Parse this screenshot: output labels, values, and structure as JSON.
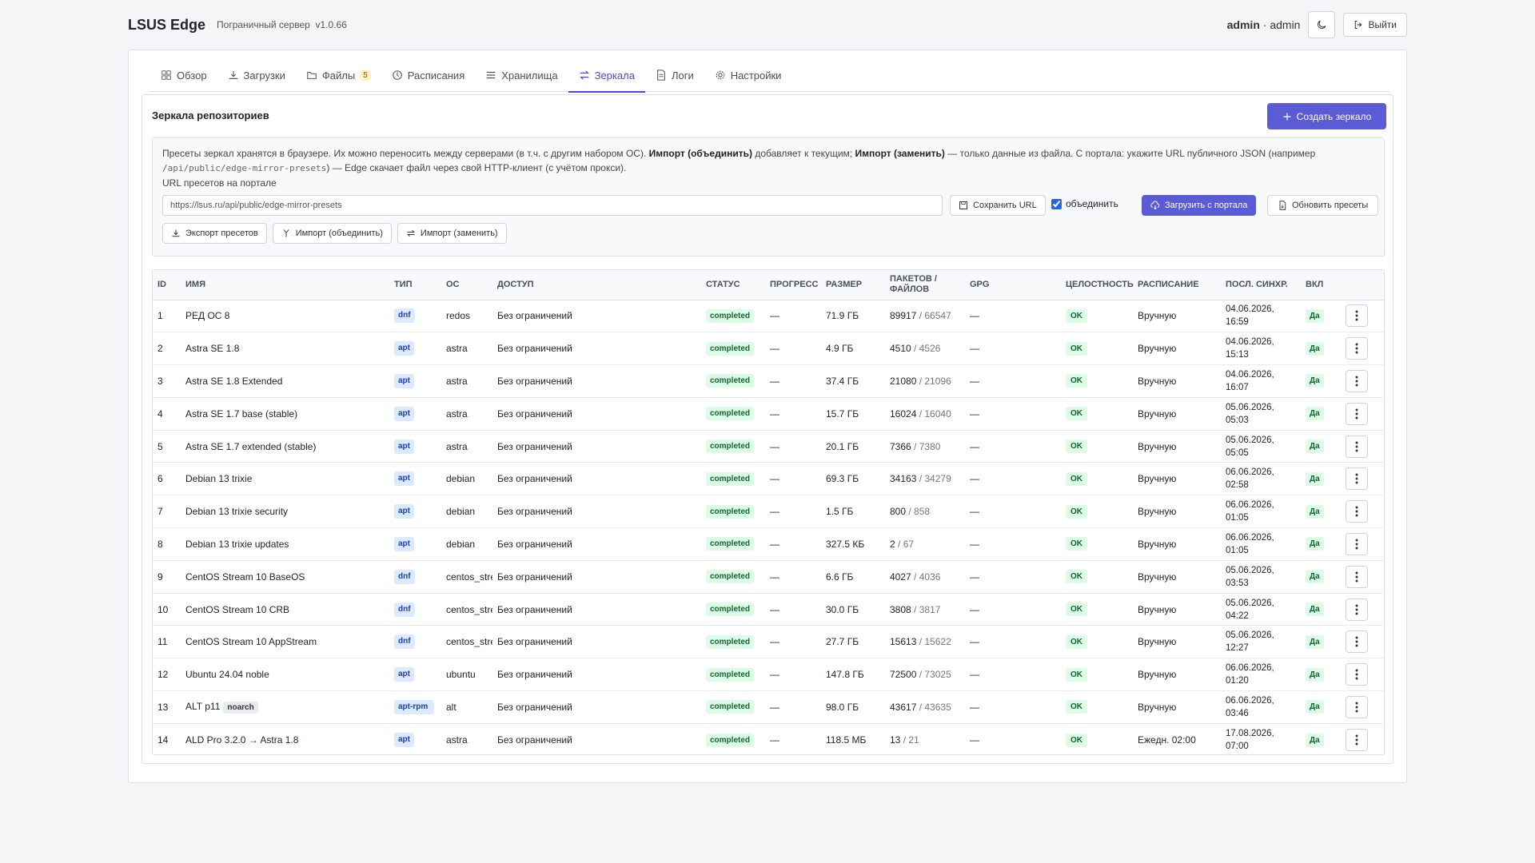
{
  "header": {
    "brand": "LSUS Edge",
    "subtitle": "Пограничный сервер",
    "version": "v1.0.66",
    "user_name": "admin",
    "user_role": "admin",
    "logout_label": "Выйти"
  },
  "tabs": [
    {
      "label": "Обзор",
      "icon": "grid-icon"
    },
    {
      "label": "Загрузки",
      "icon": "download-icon"
    },
    {
      "label": "Файлы",
      "icon": "folder-icon",
      "badge": "5"
    },
    {
      "label": "Расписания",
      "icon": "clock-icon"
    },
    {
      "label": "Хранилища",
      "icon": "list-icon"
    },
    {
      "label": "Зеркала",
      "icon": "arrows-icon",
      "active": true
    },
    {
      "label": "Логи",
      "icon": "document-icon"
    },
    {
      "label": "Настройки",
      "icon": "gear-icon"
    }
  ],
  "section": {
    "title": "Зеркала репозиториев",
    "create_label": "Создать зеркало"
  },
  "presets": {
    "info_1": "Пресеты зеркал хранятся в браузере. Их можно переносить между серверами (в т.ч. с другим набором ОС).",
    "info_import_merge": "Импорт (объединить)",
    "info_2": "добавляет к текущим;",
    "info_import_replace": "Импорт (заменить)",
    "info_3": "— только данные из файла. С портала: укажите URL публичного JSON (например",
    "info_path": "/api/public/edge-mirror-presets",
    "info_4": ") — Edge скачает файл через свой HTTP-клиент (с учётом прокси).",
    "url_label": "URL пресетов на портале",
    "url_value": "https://lsus.ru/api/public/edge-mirror-presets",
    "save_url_label": "Сохранить URL",
    "merge_label": "объединить",
    "merge_checked": true,
    "load_portal_label": "Загрузить с портала",
    "refresh_label": "Обновить пресеты",
    "export_label": "Экспорт пресетов",
    "import_merge_label": "Импорт (объединить)",
    "import_replace_label": "Импорт (заменить)"
  },
  "table": {
    "headers": [
      "ID",
      "Имя",
      "Тип",
      "ОС",
      "Доступ",
      "Статус",
      "Прогресс",
      "Размер",
      "Пакетов / файлов",
      "GPG",
      "Целостность",
      "Расписание",
      "Посл. синхр.",
      "Вкл",
      ""
    ],
    "rows": [
      {
        "id": "1",
        "name": "РЕД ОС 8",
        "tag": "",
        "type": "dnf",
        "os": "redos",
        "access": "Без ограничений",
        "status": "completed",
        "progress": "—",
        "size": "71.9 ГБ",
        "packages": "89917",
        "files": "/ 66547",
        "gpg": "—",
        "integrity": "OK",
        "schedule": "Вручную",
        "last_sync_date": "04.06.2026,",
        "last_sync_time": "16:59",
        "enabled": "Да"
      },
      {
        "id": "2",
        "name": "Astra SE 1.8",
        "tag": "",
        "type": "apt",
        "os": "astra",
        "access": "Без ограничений",
        "status": "completed",
        "progress": "—",
        "size": "4.9 ГБ",
        "packages": "4510",
        "files": "/ 4526",
        "gpg": "—",
        "integrity": "OK",
        "schedule": "Вручную",
        "last_sync_date": "04.06.2026,",
        "last_sync_time": "15:13",
        "enabled": "Да"
      },
      {
        "id": "3",
        "name": "Astra SE 1.8 Extended",
        "tag": "",
        "type": "apt",
        "os": "astra",
        "access": "Без ограничений",
        "status": "completed",
        "progress": "—",
        "size": "37.4 ГБ",
        "packages": "21080",
        "files": "/ 21096",
        "gpg": "—",
        "integrity": "OK",
        "schedule": "Вручную",
        "last_sync_date": "04.06.2026,",
        "last_sync_time": "16:07",
        "enabled": "Да"
      },
      {
        "id": "4",
        "name": "Astra SE 1.7 base (stable)",
        "tag": "",
        "type": "apt",
        "os": "astra",
        "access": "Без ограничений",
        "status": "completed",
        "progress": "—",
        "size": "15.7 ГБ",
        "packages": "16024",
        "files": "/ 16040",
        "gpg": "—",
        "integrity": "OK",
        "schedule": "Вручную",
        "last_sync_date": "05.06.2026,",
        "last_sync_time": "05:03",
        "enabled": "Да"
      },
      {
        "id": "5",
        "name": "Astra SE 1.7 extended (stable)",
        "tag": "",
        "type": "apt",
        "os": "astra",
        "access": "Без ограничений",
        "status": "completed",
        "progress": "—",
        "size": "20.1 ГБ",
        "packages": "7366",
        "files": "/ 7380",
        "gpg": "—",
        "integrity": "OK",
        "schedule": "Вручную",
        "last_sync_date": "05.06.2026,",
        "last_sync_time": "05:05",
        "enabled": "Да"
      },
      {
        "id": "6",
        "name": "Debian 13 trixie",
        "tag": "",
        "type": "apt",
        "os": "debian",
        "access": "Без ограничений",
        "status": "completed",
        "progress": "—",
        "size": "69.3 ГБ",
        "packages": "34163",
        "files": "/ 34279",
        "gpg": "—",
        "integrity": "OK",
        "schedule": "Вручную",
        "last_sync_date": "06.06.2026,",
        "last_sync_time": "02:58",
        "enabled": "Да"
      },
      {
        "id": "7",
        "name": "Debian 13 trixie security",
        "tag": "",
        "type": "apt",
        "os": "debian",
        "access": "Без ограничений",
        "status": "completed",
        "progress": "—",
        "size": "1.5 ГБ",
        "packages": "800",
        "files": "/ 858",
        "gpg": "—",
        "integrity": "OK",
        "schedule": "Вручную",
        "last_sync_date": "06.06.2026,",
        "last_sync_time": "01:05",
        "enabled": "Да"
      },
      {
        "id": "8",
        "name": "Debian 13 trixie updates",
        "tag": "",
        "type": "apt",
        "os": "debian",
        "access": "Без ограничений",
        "status": "completed",
        "progress": "—",
        "size": "327.5 КБ",
        "packages": "2",
        "files": "/ 67",
        "gpg": "—",
        "integrity": "OK",
        "schedule": "Вручную",
        "last_sync_date": "06.06.2026,",
        "last_sync_time": "01:05",
        "enabled": "Да"
      },
      {
        "id": "9",
        "name": "CentOS Stream 10 BaseOS",
        "tag": "",
        "type": "dnf",
        "os": "centos_stream",
        "access": "Без ограничений",
        "status": "completed",
        "progress": "—",
        "size": "6.6 ГБ",
        "packages": "4027",
        "files": "/ 4036",
        "gpg": "—",
        "integrity": "OK",
        "schedule": "Вручную",
        "last_sync_date": "05.06.2026,",
        "last_sync_time": "03:53",
        "enabled": "Да"
      },
      {
        "id": "10",
        "name": "CentOS Stream 10 CRB",
        "tag": "",
        "type": "dnf",
        "os": "centos_stream",
        "access": "Без ограничений",
        "status": "completed",
        "progress": "—",
        "size": "30.0 ГБ",
        "packages": "3808",
        "files": "/ 3817",
        "gpg": "—",
        "integrity": "OK",
        "schedule": "Вручную",
        "last_sync_date": "05.06.2026,",
        "last_sync_time": "04:22",
        "enabled": "Да"
      },
      {
        "id": "11",
        "name": "CentOS Stream 10 AppStream",
        "tag": "",
        "type": "dnf",
        "os": "centos_stream",
        "access": "Без ограничений",
        "status": "completed",
        "progress": "—",
        "size": "27.7 ГБ",
        "packages": "15613",
        "files": "/ 15622",
        "gpg": "—",
        "integrity": "OK",
        "schedule": "Вручную",
        "last_sync_date": "05.06.2026,",
        "last_sync_time": "12:27",
        "enabled": "Да"
      },
      {
        "id": "12",
        "name": "Ubuntu 24.04 noble",
        "tag": "",
        "type": "apt",
        "os": "ubuntu",
        "access": "Без ограничений",
        "status": "completed",
        "progress": "—",
        "size": "147.8 ГБ",
        "packages": "72500",
        "files": "/ 73025",
        "gpg": "—",
        "integrity": "OK",
        "schedule": "Вручную",
        "last_sync_date": "06.06.2026,",
        "last_sync_time": "01:20",
        "enabled": "Да"
      },
      {
        "id": "13",
        "name": "ALT p11",
        "tag": "noarch",
        "type": "apt-rpm",
        "os": "alt",
        "access": "Без ограничений",
        "status": "completed",
        "progress": "—",
        "size": "98.0 ГБ",
        "packages": "43617",
        "files": "/ 43635",
        "gpg": "—",
        "integrity": "OK",
        "schedule": "Вручную",
        "last_sync_date": "06.06.2026,",
        "last_sync_time": "03:46",
        "enabled": "Да"
      },
      {
        "id": "14",
        "name": "ALD Pro 3.2.0 → Astra 1.8",
        "tag": "",
        "type": "apt",
        "os": "astra",
        "access": "Без ограничений",
        "status": "completed",
        "progress": "—",
        "size": "118.5 МБ",
        "packages": "13",
        "files": "/ 21",
        "gpg": "—",
        "integrity": "OK",
        "schedule": "Ежедн. 02:00",
        "last_sync_date": "17.08.2026,",
        "last_sync_time": "07:00",
        "enabled": "Да"
      }
    ]
  },
  "colors": {
    "accent": "#5b5bd6",
    "active_tab": "#4f46e5",
    "status_bg": "#dcfce7",
    "status_text": "#166534",
    "type_bg": "#dbeafe"
  }
}
